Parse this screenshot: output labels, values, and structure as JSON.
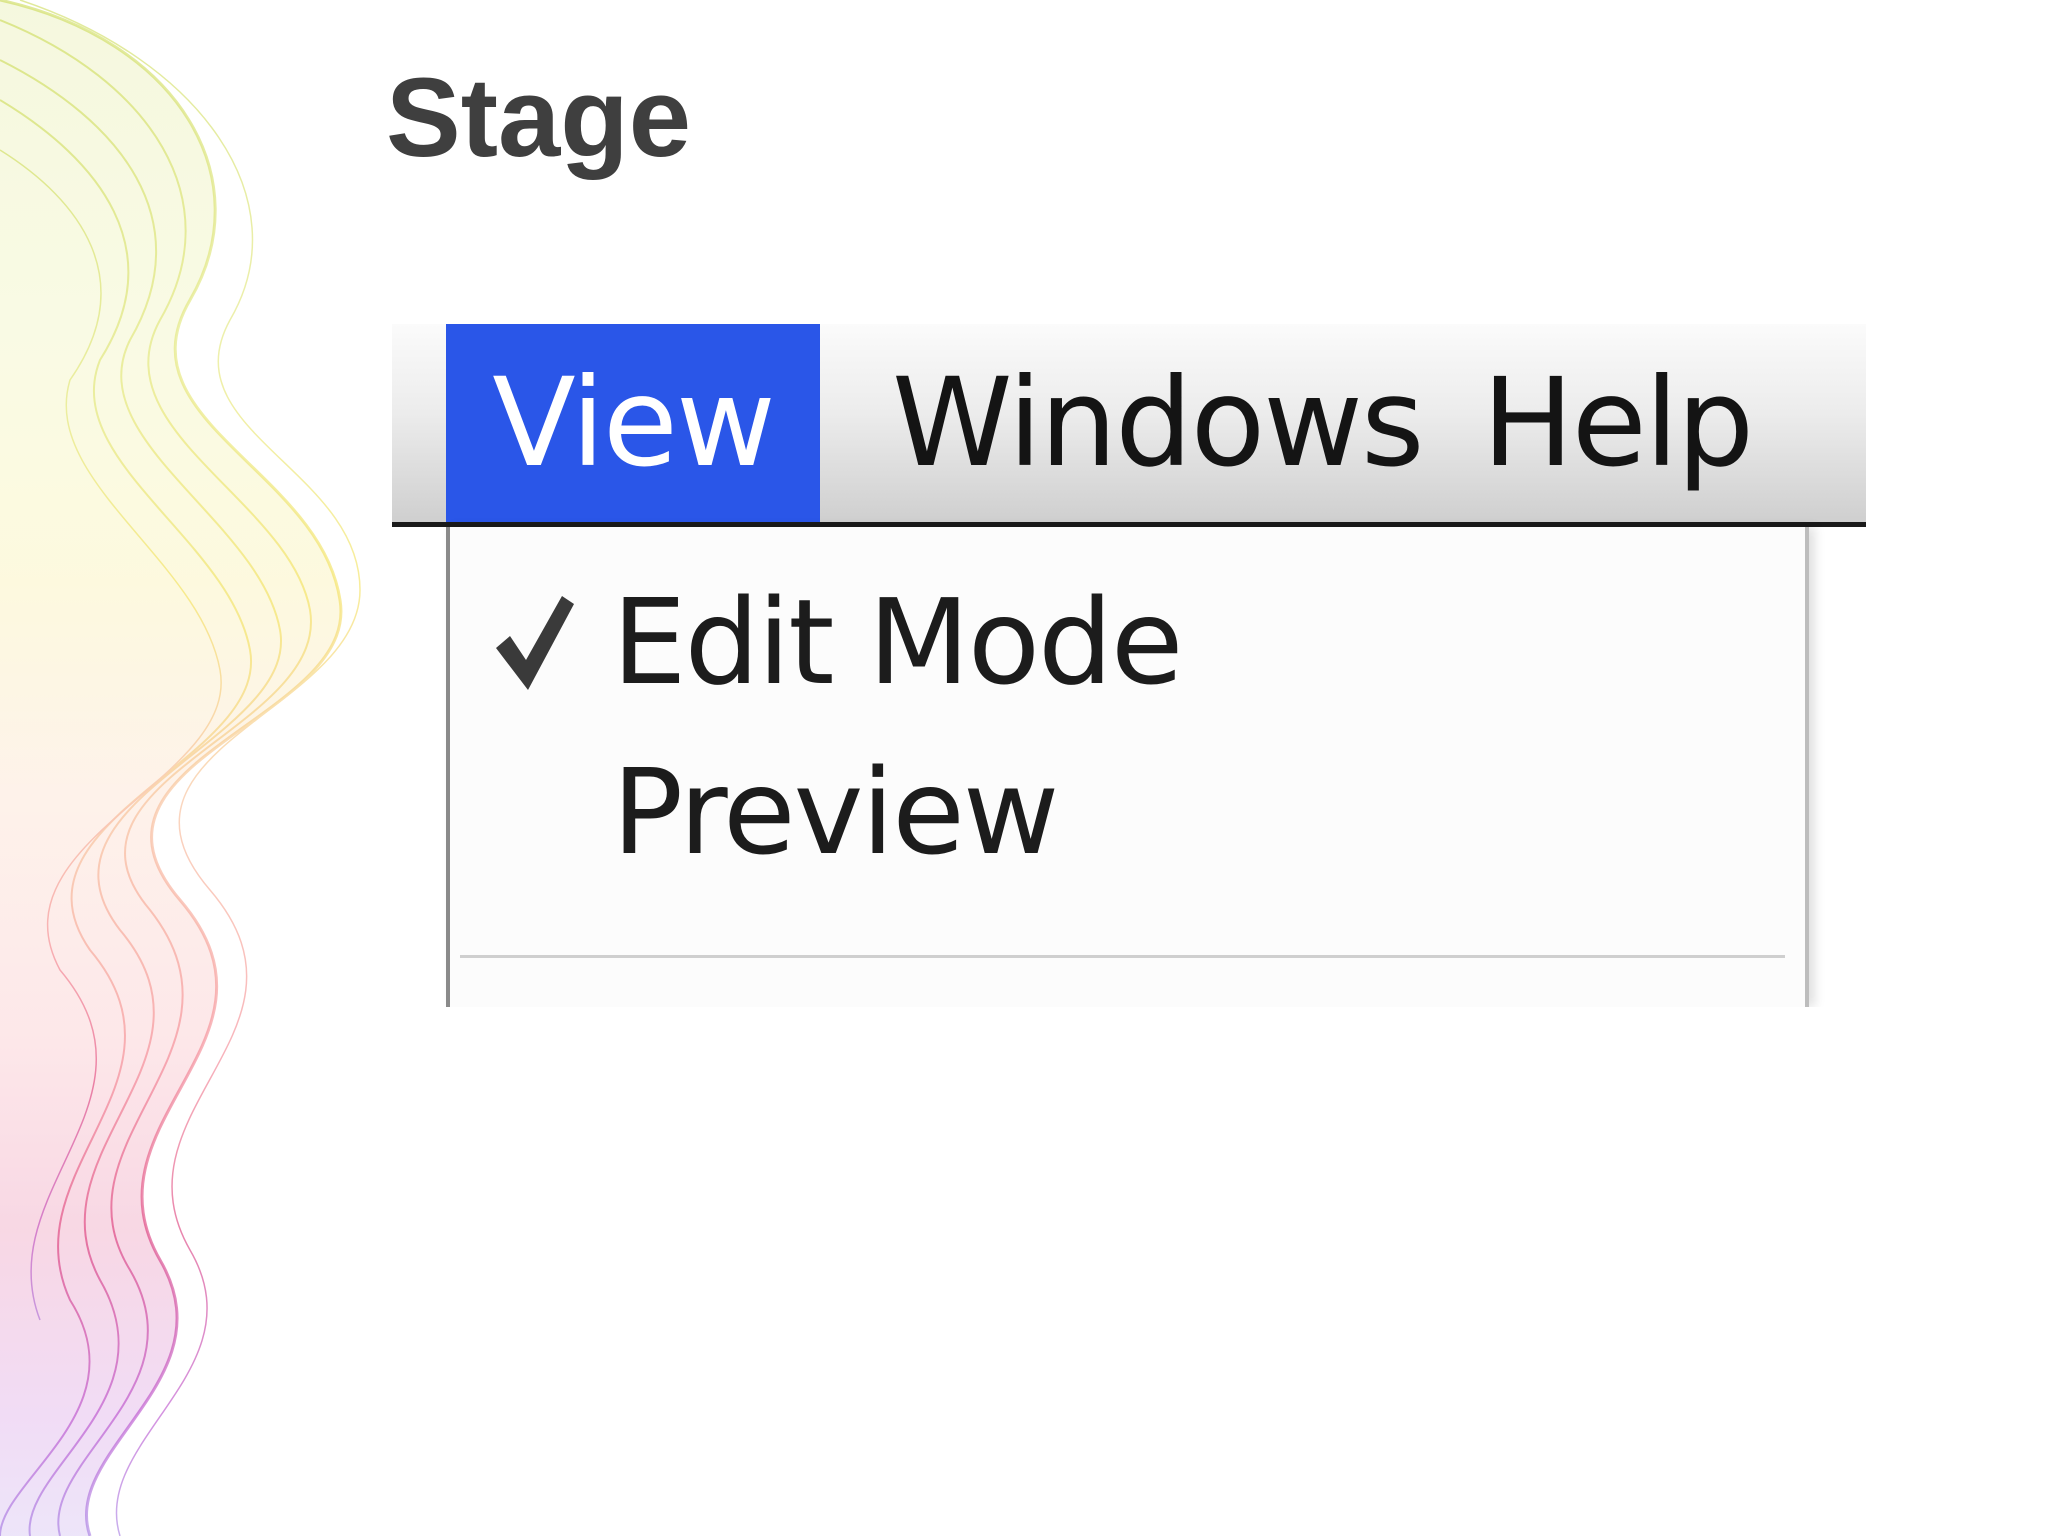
{
  "slide": {
    "title": "Stage"
  },
  "menubar": {
    "menus": [
      {
        "label": "View",
        "active": true
      },
      {
        "label": "Windows",
        "active": false
      },
      {
        "label": "Help",
        "active": false
      }
    ]
  },
  "view_menu": {
    "items": [
      {
        "label": "Edit Mode",
        "checked": true,
        "icon": "checkmark-icon"
      },
      {
        "label": "Preview",
        "checked": false
      }
    ]
  },
  "colors": {
    "active_menu": "#2a56e8",
    "title_text": "#3f3f3f"
  }
}
